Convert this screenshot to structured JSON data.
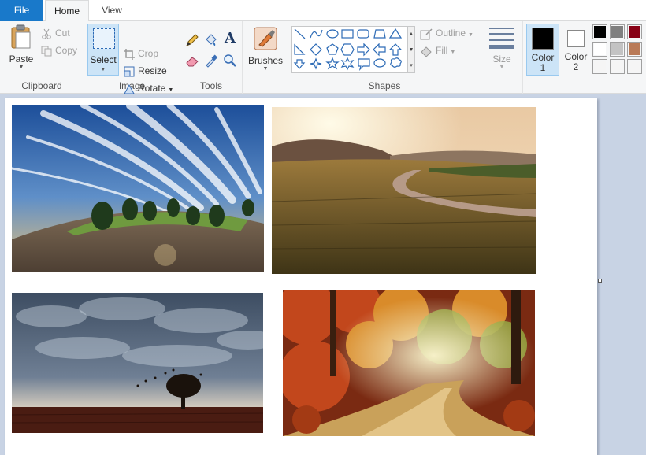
{
  "tabs": {
    "file": "File",
    "home": "Home",
    "view": "View"
  },
  "clipboard": {
    "paste": "Paste",
    "cut": "Cut",
    "copy": "Copy",
    "group": "Clipboard"
  },
  "image": {
    "select": "Select",
    "crop": "Crop",
    "resize": "Resize",
    "rotate": "Rotate",
    "group": "Image"
  },
  "tools": {
    "group": "Tools",
    "icons": [
      "pencil-icon",
      "fill-bucket-icon",
      "text-icon",
      "eraser-icon",
      "color-picker-icon",
      "magnifier-icon"
    ]
  },
  "brushes": {
    "label": "Brushes"
  },
  "shapes": {
    "group": "Shapes",
    "outline": "Outline",
    "fill": "Fill"
  },
  "size": {
    "label": "Size"
  },
  "colors": {
    "color1_label": "Color",
    "color1_num": "1",
    "color1": "#000000",
    "color2_label": "Color",
    "color2_num": "2",
    "color2": "#ffffff",
    "palette": [
      "#000000",
      "#7f7f7f",
      "#880015",
      "#ffffff",
      "#c3c3c3",
      "#b97a57",
      "#f5f5f5",
      "#f5f5f5",
      "#f5f5f5"
    ]
  },
  "canvas": {
    "images": [
      "sky-clouds-trees-photo",
      "sunset-field-road-photo",
      "stormy-sky-tree-photo",
      "autumn-forest-path-photo"
    ]
  }
}
